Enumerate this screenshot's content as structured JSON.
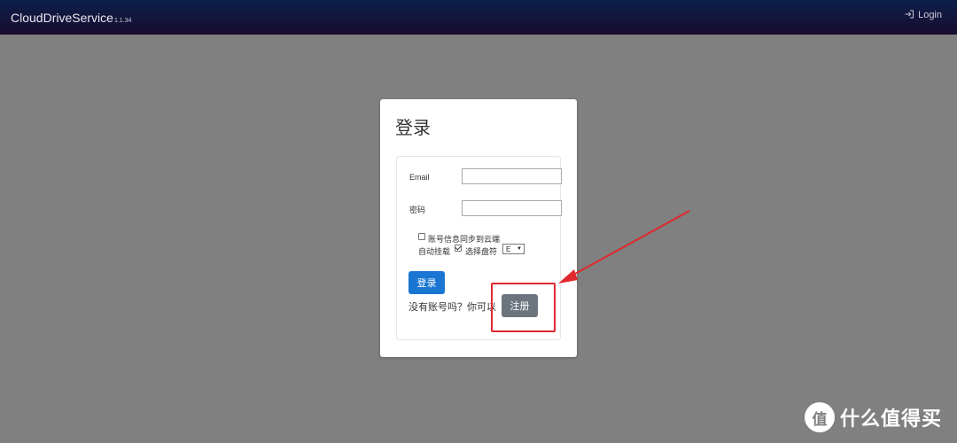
{
  "navbar": {
    "brand": "CloudDriveService",
    "version": "1.1.34",
    "login_label": "Login"
  },
  "card": {
    "title": "登录"
  },
  "form": {
    "email_label": "Email",
    "email_value": "",
    "password_label": "密码",
    "password_value": "",
    "sync_label": "账号信息同步到云端",
    "sync_checked": false,
    "automount_label": "自动挂载",
    "automount_checked": true,
    "drive_letter_label": "选择盘符",
    "drive_letter_value": "E",
    "login_button": "登录",
    "register_prompt": "没有账号吗？你可以",
    "register_button": "注册"
  },
  "watermark": {
    "logo_glyph": "值",
    "text": "什么值得买"
  },
  "colors": {
    "navbar": "#0c1e4a",
    "background": "#808080",
    "primary_button": "#1a76d2",
    "secondary_button": "#6c757d",
    "annotation": "#e0282e"
  }
}
